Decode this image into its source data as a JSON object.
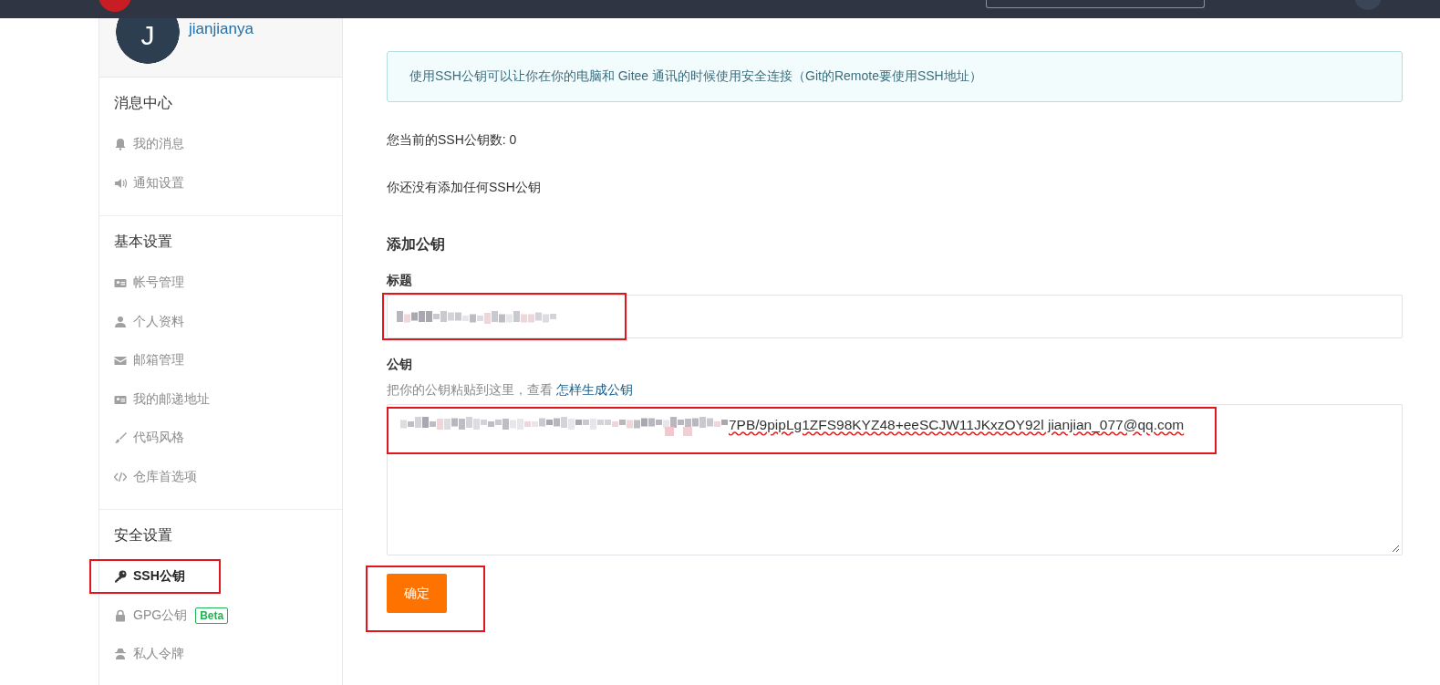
{
  "profile": {
    "avatar_letter": "J",
    "username": "jianjianya"
  },
  "sidebar": {
    "groups": [
      {
        "title": "消息中心",
        "items": [
          {
            "label": "我的消息",
            "kind": "bell",
            "selected": false,
            "highlighted": false
          },
          {
            "label": "通知设置",
            "kind": "speaker",
            "selected": false,
            "highlighted": false
          }
        ]
      },
      {
        "title": "基本设置",
        "items": [
          {
            "label": "帐号管理",
            "kind": "card",
            "selected": false,
            "highlighted": false
          },
          {
            "label": "个人资料",
            "kind": "user",
            "selected": false,
            "highlighted": false
          },
          {
            "label": "邮箱管理",
            "kind": "mail",
            "selected": false,
            "highlighted": false
          },
          {
            "label": "我的邮递地址",
            "kind": "card",
            "selected": false,
            "highlighted": false
          },
          {
            "label": "代码风格",
            "kind": "brush",
            "selected": false,
            "highlighted": false
          },
          {
            "label": "仓库首选项",
            "kind": "code",
            "selected": false,
            "highlighted": false
          }
        ]
      },
      {
        "title": "安全设置",
        "items": [
          {
            "label": "SSH公钥",
            "kind": "key",
            "selected": true,
            "highlighted": true
          },
          {
            "label": "GPG公钥",
            "kind": "lock",
            "selected": false,
            "highlighted": false,
            "badge": "Beta"
          },
          {
            "label": "私人令牌",
            "kind": "spy",
            "selected": false,
            "highlighted": false
          }
        ]
      }
    ]
  },
  "info_box": "使用SSH公钥可以让你在你的电脑和 Gitee 通讯的时候使用安全连接（Git的Remote要使用SSH地址）",
  "key_count": "您当前的SSH公钥数: 0",
  "empty_message": "你还没有添加任何SSH公钥",
  "form": {
    "title": "添加公钥",
    "title_field": {
      "label": "标题",
      "redacted": true,
      "highlighted": true
    },
    "key_field": {
      "label": "公钥",
      "hint": "把你的公钥粘贴到这里，查看",
      "hint_link": "怎样生成公钥",
      "value": "7PB/9pipLg1ZFS98KYZ48+eeSCJW11JKxzOY92l jianjian_077@qq.com",
      "redacted_prefix": true,
      "highlighted": true
    },
    "submit": {
      "label": "确定",
      "highlighted": true
    }
  }
}
